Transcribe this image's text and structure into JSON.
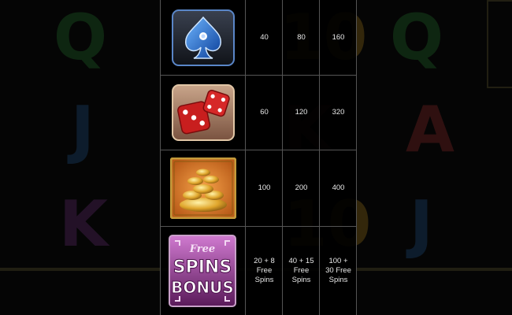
{
  "background": {
    "reel_letters": [
      "Q",
      "10",
      "Q",
      "J",
      "K",
      "A",
      "K",
      "10",
      "J"
    ]
  },
  "paytable": {
    "rows": [
      {
        "symbol": "spade-symbol",
        "pays": [
          "40",
          "80",
          "160"
        ]
      },
      {
        "symbol": "dice-symbol",
        "pays": [
          "60",
          "120",
          "320"
        ]
      },
      {
        "symbol": "gold-coins-symbol",
        "pays": [
          "100",
          "200",
          "400"
        ]
      },
      {
        "symbol": "free-spins-bonus-symbol",
        "pays": [
          "20 + 8 Free Spins",
          "40 + 15 Free Spins",
          "100 + 30 Free Spins"
        ]
      }
    ],
    "bonus_logo": {
      "line1": "Free",
      "line2": "SPINS",
      "line3": "BONUS"
    }
  },
  "colors": {
    "spade": "#1d6fd6",
    "dice": "#c81e1e",
    "coins": "#e0a62c",
    "bonus": "#8a2e8a"
  }
}
